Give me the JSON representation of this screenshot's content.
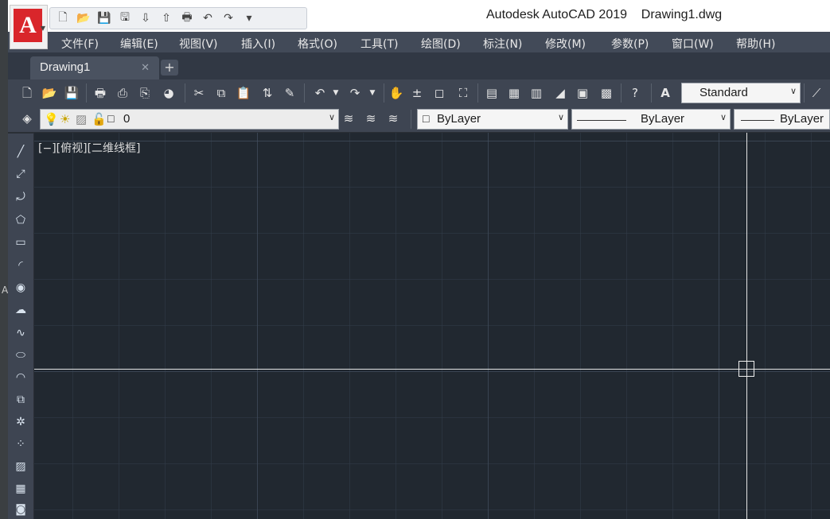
{
  "window": {
    "app_title": "Autodesk AutoCAD 2019",
    "file_name": "Drawing1.dwg"
  },
  "app_button": {
    "letter": "A"
  },
  "quick_access": [
    {
      "name": "new-icon",
      "glyph": "🗋"
    },
    {
      "name": "open-icon",
      "glyph": "📂"
    },
    {
      "name": "save-icon",
      "glyph": "💾"
    },
    {
      "name": "save-as-icon",
      "glyph": "🖫"
    },
    {
      "name": "open-from-web-icon",
      "glyph": "⇩"
    },
    {
      "name": "save-to-web-icon",
      "glyph": "⇧"
    },
    {
      "name": "plot-icon",
      "glyph": "🖶"
    },
    {
      "name": "undo-icon",
      "glyph": "↶"
    },
    {
      "name": "redo-icon",
      "glyph": "↷"
    },
    {
      "name": "customize-qat-icon",
      "glyph": "▾"
    }
  ],
  "menu": [
    "文件(F)",
    "编辑(E)",
    "视图(V)",
    "插入(I)",
    "格式(O)",
    "工具(T)",
    "绘图(D)",
    "标注(N)",
    "修改(M)",
    "参数(P)",
    "窗口(W)",
    "帮助(H)"
  ],
  "tab": {
    "label": "Drawing1",
    "close": "✕",
    "new_tab": "+"
  },
  "standard_toolbar": {
    "text_style": "Standard"
  },
  "layer_toolbar": {
    "current_layer": "0",
    "color": "ByLayer",
    "linetype": "ByLayer",
    "lineweight": "ByLayer"
  },
  "viewport": {
    "label": "[−][俯视][二维线框]"
  },
  "desktop_edge": {
    "letter": "A"
  },
  "colors": {
    "canvas": "#212830",
    "menubar": "#424a58",
    "toolbar": "#3e4552",
    "brand_red": "#d9262b"
  }
}
